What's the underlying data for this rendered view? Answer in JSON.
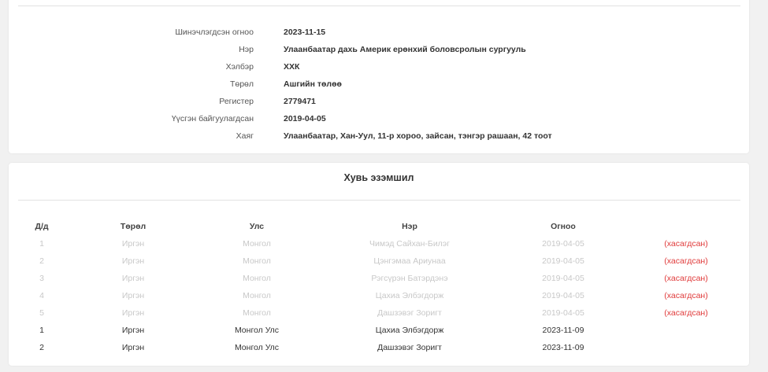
{
  "company": {
    "fields": [
      {
        "label": "Шинэчлэгдсэн огноо",
        "value": "2023-11-15"
      },
      {
        "label": "Нэр",
        "value": "Улаанбаатар дахь Америк ерөнхий боловсролын сургууль"
      },
      {
        "label": "Хэлбэр",
        "value": "ХХК"
      },
      {
        "label": "Төрөл",
        "value": "Ашгийн төлөө"
      },
      {
        "label": "Регистер",
        "value": "2779471"
      },
      {
        "label": "Үүсгэн байгуулагдсан",
        "value": "2019-04-05"
      },
      {
        "label": "Хаяг",
        "value": "Улаанбаатар, Хан-Уул, 11-р хороо, зайсан, тэнгэр рашаан, 42 тоот"
      }
    ]
  },
  "ownership": {
    "title": "Хувь эзэмшил",
    "headers": [
      "Д/д",
      "Төрөл",
      "Улс",
      "Нэр",
      "Огноо",
      ""
    ],
    "rows": [
      {
        "idx": "1",
        "type": "Иргэн",
        "country": "Монгол",
        "name": "Чимэд Сайхан-Билэг",
        "date": "2019-04-05",
        "status": "(хасагдсан)"
      },
      {
        "idx": "2",
        "type": "Иргэн",
        "country": "Монгол",
        "name": "Цэнгэмаа Ариунаа",
        "date": "2019-04-05",
        "status": "(хасагдсан)"
      },
      {
        "idx": "3",
        "type": "Иргэн",
        "country": "Монгол",
        "name": "Рэгсүрэн Батэрдэнэ",
        "date": "2019-04-05",
        "status": "(хасагдсан)"
      },
      {
        "idx": "4",
        "type": "Иргэн",
        "country": "Монгол",
        "name": "Цахиа Элбэгдорж",
        "date": "2019-04-05",
        "status": "(хасагдсан)"
      },
      {
        "idx": "5",
        "type": "Иргэн",
        "country": "Монгол",
        "name": "Дашзэвэг Зоригт",
        "date": "2019-04-05",
        "status": "(хасагдсан)"
      },
      {
        "idx": "1",
        "type": "Иргэн",
        "country": "Монгол Улс",
        "name": "Цахиа Элбэгдорж",
        "date": "2023-11-09",
        "status": ""
      },
      {
        "idx": "2",
        "type": "Иргэн",
        "country": "Монгол Улс",
        "name": "Дашзэвэг Зоригт",
        "date": "2023-11-09",
        "status": ""
      }
    ]
  },
  "colors": {
    "background": "#f1f1f1",
    "card": "#ffffff",
    "removed_text": "#c8c8c8",
    "removed_badge": "#e03b3b"
  }
}
